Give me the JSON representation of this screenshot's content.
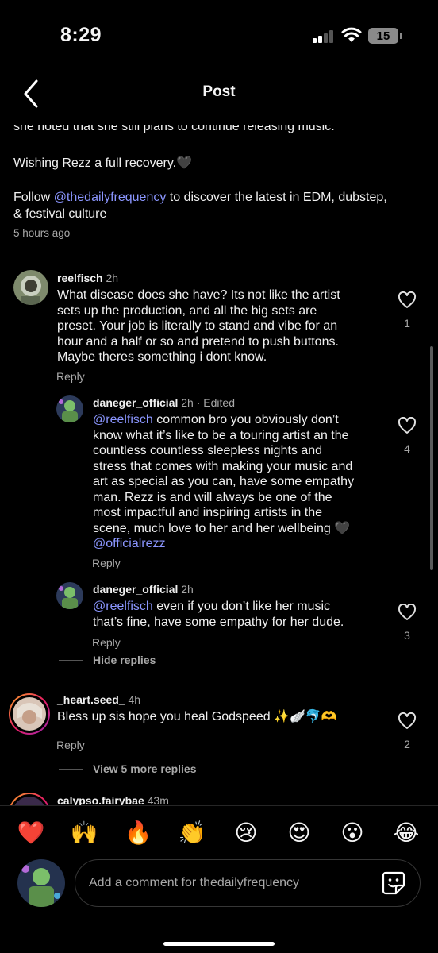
{
  "status_bar": {
    "time": "8:29",
    "battery": "15"
  },
  "header": {
    "title": "Post"
  },
  "caption": {
    "cut_line": "she noted that she still plans to continue releasing music.",
    "wish_text": "Wishing Rezz a full recovery.🖤",
    "follow_prefix": "Follow ",
    "follow_mention": "@thedailyfrequency",
    "follow_line1_suffix": " to discover the latest in EDM, dubstep,",
    "follow_line2": "& festival culture",
    "timestamp": "5 hours ago"
  },
  "comments": [
    {
      "username": "reelfisch",
      "time": "2h",
      "lines": [
        "What disease does she have? Its not like the artist",
        "sets up the production, and all the big sets are",
        "preset. Your job is literally to stand and vibe for an",
        "hour and a half or so and pretend to push buttons.",
        "Maybe theres something i dont know."
      ],
      "reply_label": "Reply",
      "likes": "1"
    },
    {
      "username": "daneger_official",
      "time": "2h · Edited",
      "mention": "@reelfisch",
      "line1_rest": " common bro you obviously don’t",
      "lines": [
        "know what it’s like to be a touring artist an the",
        "countless countless sleepless nights and",
        "stress that comes with making your music and",
        "art as special as you can, have some empathy",
        "man. Rezz is and will always be one of the",
        "most impactful and inspiring artists in the",
        "scene, much love to her and her wellbeing 🖤"
      ],
      "end_mention": "@officialrezz",
      "reply_label": "Reply",
      "likes": "4"
    },
    {
      "username": "daneger_official",
      "time": "2h",
      "mention": "@reelfisch",
      "line1_rest": " even if you don’t like her music",
      "lines": [
        "that’s fine, have some empathy for her dude."
      ],
      "reply_label": "Reply",
      "likes": "3"
    },
    {
      "username": "_heart.seed_",
      "time": "4h",
      "lines": [
        "Bless up sis hope you heal Godspeed ✨🪽🐬🫶"
      ],
      "reply_label": "Reply",
      "likes": "2"
    },
    {
      "username": "calypso.fairybae",
      "time": "43m"
    }
  ],
  "threads": {
    "hide_replies": "Hide replies",
    "view_more": "View 5 more replies"
  },
  "emoji_bar": [
    "❤️",
    "🙌",
    "🔥",
    "👏",
    "😢",
    "😍",
    "😮",
    "😂"
  ],
  "composer": {
    "placeholder": "Add a comment for thedailyfrequency"
  },
  "colors": {
    "mention": "#8b96ff",
    "muted": "#a8a8a8",
    "background": "#000000"
  }
}
